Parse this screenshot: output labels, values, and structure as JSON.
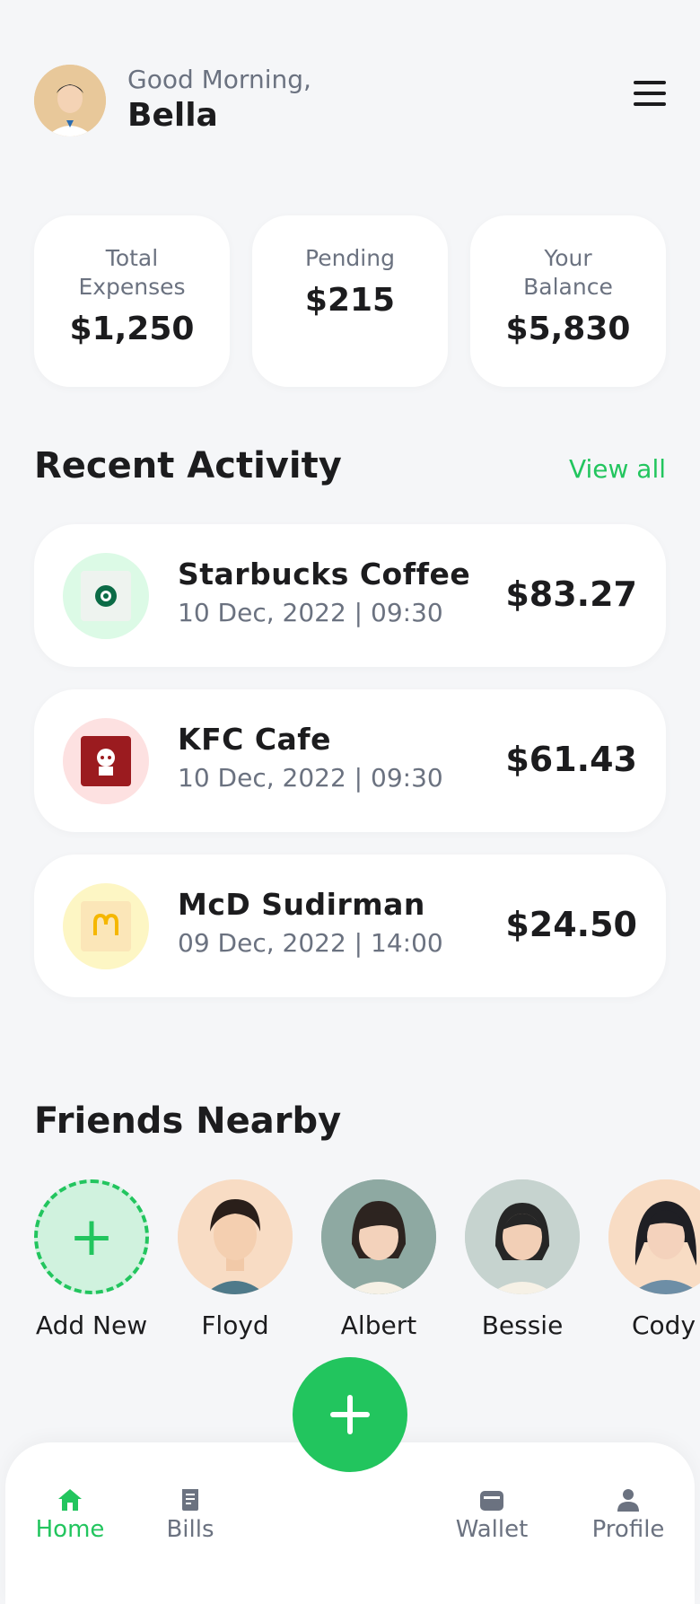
{
  "header": {
    "greeting": "Good Morning,",
    "name": "Bella"
  },
  "stats": [
    {
      "label": "Total Expenses",
      "value": "$1,250"
    },
    {
      "label": "Pending",
      "value": "$215"
    },
    {
      "label": "Your Balance",
      "value": "$5,830"
    }
  ],
  "recent": {
    "title": "Recent Activity",
    "view_all": "View all",
    "items": [
      {
        "title": "Starbucks Coffee",
        "date": "10 Dec, 2022 | 09:30",
        "amount": "$83.27",
        "icon": "starbucks-logo-icon"
      },
      {
        "title": "KFC Cafe",
        "date": "10 Dec, 2022 | 09:30",
        "amount": "$61.43",
        "icon": "kfc-logo-icon"
      },
      {
        "title": "McD Sudirman",
        "date": "09 Dec, 2022 | 14:00",
        "amount": "$24.50",
        "icon": "mcdonalds-logo-icon"
      }
    ]
  },
  "friends": {
    "title": "Friends Nearby",
    "add_label": "Add New",
    "items": [
      {
        "name": "Floyd"
      },
      {
        "name": "Albert"
      },
      {
        "name": "Bessie"
      },
      {
        "name": "Cody"
      }
    ]
  },
  "nav": {
    "home": "Home",
    "bills": "Bills",
    "wallet": "Wallet",
    "profile": "Profile"
  },
  "colors": {
    "accent": "#22c55e",
    "background": "#f5f6f8",
    "muted": "#6b7280"
  }
}
